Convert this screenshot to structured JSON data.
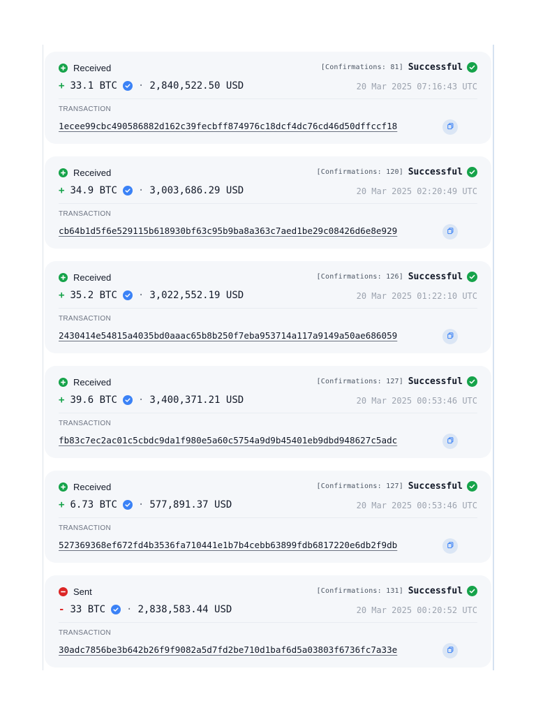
{
  "labels": {
    "transaction": "TRANSACTION",
    "confirmations_prefix": "[Confirmations:",
    "confirmations_suffix": "]",
    "dot": "·"
  },
  "colors": {
    "received": "#16a34a",
    "sent": "#dc2626",
    "verified": "#3b82f6",
    "success": "#16a34a"
  },
  "icons": {
    "received": "plus-circle-icon",
    "sent": "minus-circle-icon",
    "success": "check-circle-icon",
    "verified": "verified-badge-icon",
    "copy": "copy-icon"
  },
  "transactions": [
    {
      "direction": "Received",
      "type": "received",
      "confirmations": "81",
      "status": "Successful",
      "sign": "+",
      "amount": "33.1 BTC",
      "usd": "2,840,522.50 USD",
      "time": "20 Mar 2025 07:16:43 UTC",
      "hash": "1ecee99cbc490586882d162c39fecbff874976c18dcf4dc76cd46d50dffccf18"
    },
    {
      "direction": "Received",
      "type": "received",
      "confirmations": "120",
      "status": "Successful",
      "sign": "+",
      "amount": "34.9 BTC",
      "usd": "3,003,686.29 USD",
      "time": "20 Mar 2025 02:20:49 UTC",
      "hash": "cb64b1d5f6e529115b618930bf63c95b9ba8a363c7aed1be29c08426d6e8e929"
    },
    {
      "direction": "Received",
      "type": "received",
      "confirmations": "126",
      "status": "Successful",
      "sign": "+",
      "amount": "35.2 BTC",
      "usd": "3,022,552.19 USD",
      "time": "20 Mar 2025 01:22:10 UTC",
      "hash": "2430414e54815a4035bd0aaac65b8b250f7eba953714a117a9149a50ae686059"
    },
    {
      "direction": "Received",
      "type": "received",
      "confirmations": "127",
      "status": "Successful",
      "sign": "+",
      "amount": "39.6 BTC",
      "usd": "3,400,371.21 USD",
      "time": "20 Mar 2025 00:53:46 UTC",
      "hash": "fb83c7ec2ac01c5cbdc9da1f980e5a60c5754a9d9b45401eb9dbd948627c5adc"
    },
    {
      "direction": "Received",
      "type": "received",
      "confirmations": "127",
      "status": "Successful",
      "sign": "+",
      "amount": "6.73 BTC",
      "usd": "577,891.37 USD",
      "time": "20 Mar 2025 00:53:46 UTC",
      "hash": "527369368ef672fd4b3536fa710441e1b7b4cebb63899fdb6817220e6db2f9db"
    },
    {
      "direction": "Sent",
      "type": "sent",
      "confirmations": "131",
      "status": "Successful",
      "sign": "-",
      "amount": "33 BTC",
      "usd": "2,838,583.44 USD",
      "time": "20 Mar 2025 00:20:52 UTC",
      "hash": "30adc7856be3b642b26f9f9082a5d7fd2be710d1baf6d5a03803f6736fc7a33e"
    }
  ]
}
